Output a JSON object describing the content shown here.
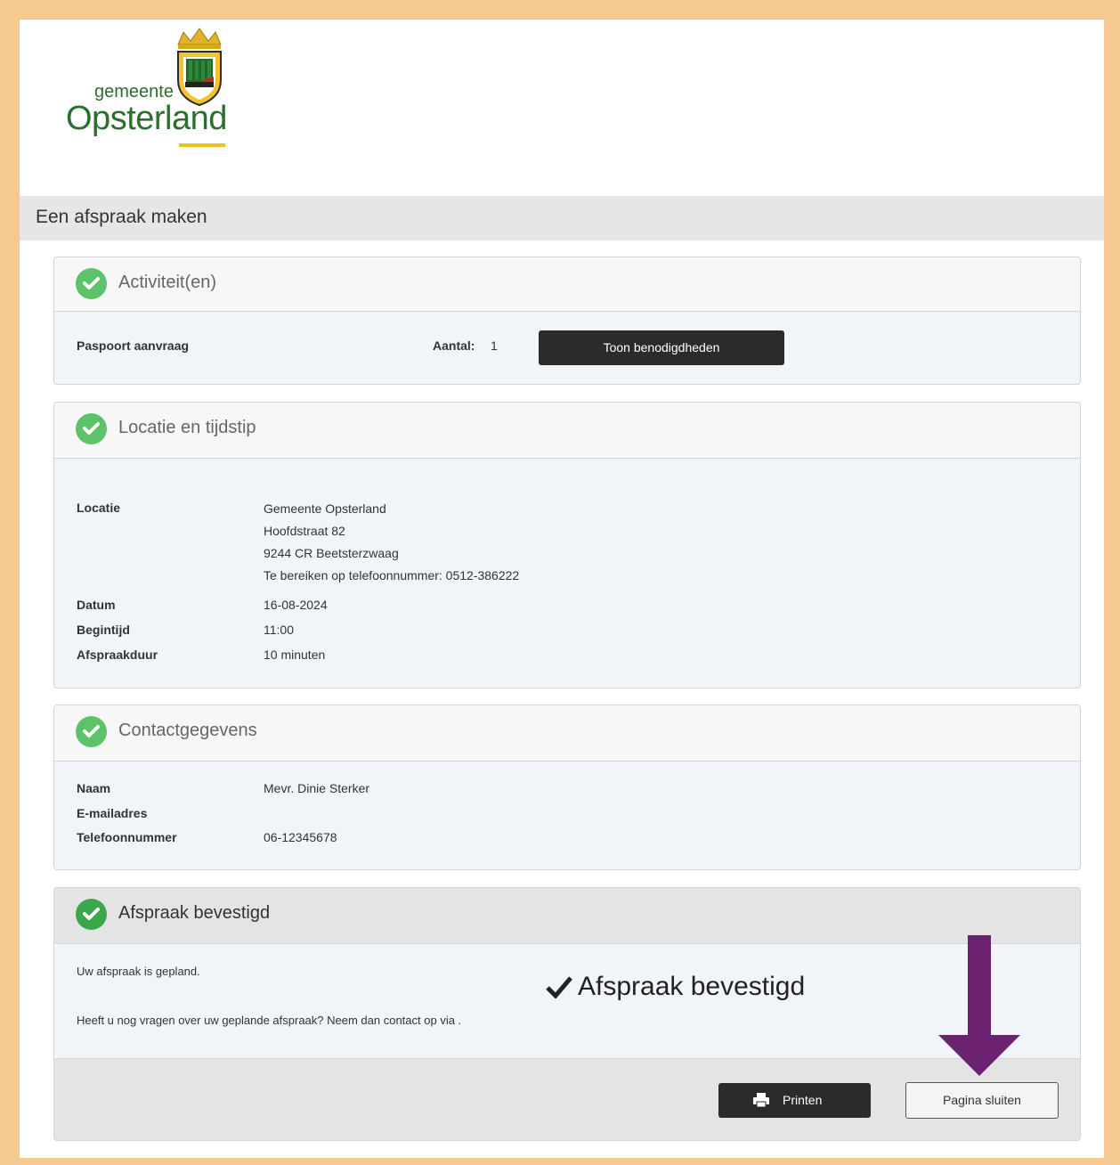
{
  "logo": {
    "line1": "gemeente",
    "line2": "Opsterland"
  },
  "page_title": "Een afspraak maken",
  "activities": {
    "title": "Activiteit(en)",
    "item": "Paspoort aanvraag",
    "count_label": "Aantal:",
    "count_value": "1",
    "button": "Toon benodigdheden"
  },
  "location": {
    "title": "Locatie en tijdstip",
    "rows": [
      {
        "label": "Locatie",
        "lines": [
          "Gemeente Opsterland",
          "Hoofdstraat 82",
          "9244 CR Beetsterzwaag",
          "Te bereiken op telefoonnummer: 0512-386222"
        ]
      },
      {
        "label": "Datum",
        "value": "16-08-2024"
      },
      {
        "label": "Begintijd",
        "value": "11:00"
      },
      {
        "label": "Afspraakduur",
        "value": "10 minuten"
      }
    ]
  },
  "contact": {
    "title": "Contactgegevens",
    "rows": [
      {
        "label": "Naam",
        "value": "Mevr. Dinie Sterker"
      },
      {
        "label": "E-mailadres",
        "value": ""
      },
      {
        "label": "Telefoonnummer",
        "value": "06-12345678"
      }
    ]
  },
  "confirmed": {
    "title": "Afspraak bevestigd",
    "message1": "Uw afspraak is gepland.",
    "message2": "Heeft u nog vragen over uw geplande afspraak? Neem dan contact op via .",
    "big_label": "Afspraak bevestigd",
    "print_button": "Printen",
    "close_button": "Pagina sluiten"
  },
  "colors": {
    "accent_arrow": "#6b2270",
    "check_green": "#5cc36a",
    "frame": "#f6c992"
  }
}
